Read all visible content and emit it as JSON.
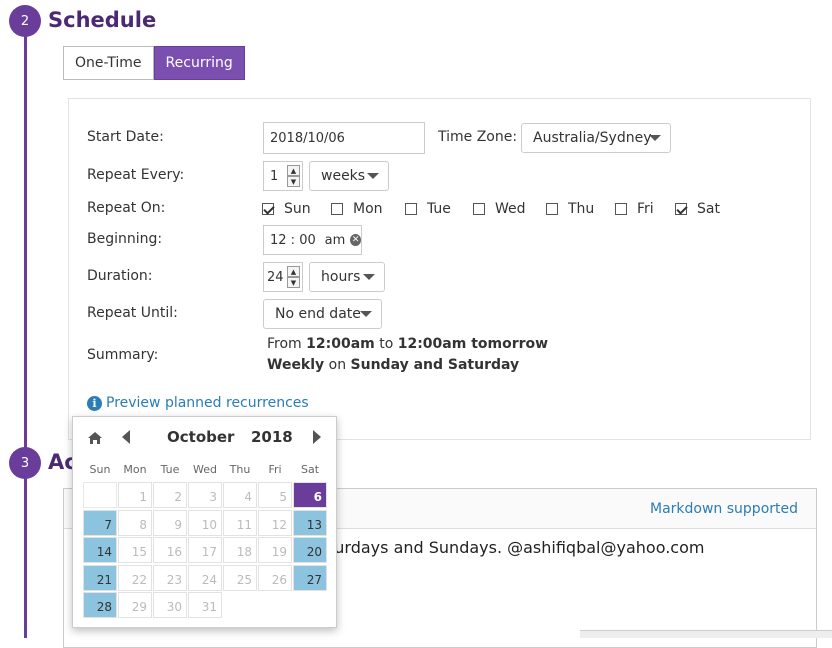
{
  "steps": [
    {
      "number": "2",
      "title": "Schedule"
    },
    {
      "number": "3",
      "title": "Ac"
    }
  ],
  "schedule_type": {
    "one_time": "One-Time",
    "recurring": "Recurring",
    "selected": "Recurring"
  },
  "form": {
    "start_date_label": "Start Date:",
    "start_date_value": "2018/10/06",
    "timezone_label": "Time Zone:",
    "timezone_value": "Australia/Sydney",
    "repeat_every_label": "Repeat Every:",
    "repeat_every_value": "1",
    "repeat_every_unit": "weeks",
    "repeat_on_label": "Repeat On:",
    "days": [
      {
        "label": "Sun",
        "checked": true
      },
      {
        "label": "Mon",
        "checked": false
      },
      {
        "label": "Tue",
        "checked": false
      },
      {
        "label": "Wed",
        "checked": false
      },
      {
        "label": "Thu",
        "checked": false
      },
      {
        "label": "Fri",
        "checked": false
      },
      {
        "label": "Sat",
        "checked": true
      }
    ],
    "beginning_label": "Beginning:",
    "beginning_hour": "12",
    "beginning_minute": "00",
    "beginning_ampm": "am",
    "duration_label": "Duration:",
    "duration_value": "24",
    "duration_unit": "hours",
    "repeat_until_label": "Repeat Until:",
    "repeat_until_value": "No end date",
    "summary_label": "Summary:",
    "summary": {
      "from": "From",
      "start": "12:00am",
      "to": "to",
      "end": "12:00am tomorrow",
      "frequency": "Weekly",
      "on": "on",
      "days": "Sunday and Saturday"
    },
    "preview_link": "Preview planned recurrences"
  },
  "editor": {
    "markdown_label": "Markdown supported",
    "text": "turdays and Sundays. @ashifiqbal@yahoo.com"
  },
  "calendar": {
    "month": "October",
    "year": "2018",
    "weekdays": [
      "Sun",
      "Mon",
      "Tue",
      "Wed",
      "Thu",
      "Fri",
      "Sat"
    ],
    "selected_day": 6,
    "weeks": [
      [
        null,
        1,
        2,
        3,
        4,
        5,
        6
      ],
      [
        7,
        8,
        9,
        10,
        11,
        12,
        13
      ],
      [
        14,
        15,
        16,
        17,
        18,
        19,
        20
      ],
      [
        21,
        22,
        23,
        24,
        25,
        26,
        27
      ],
      [
        28,
        29,
        30,
        31,
        null,
        null,
        null
      ]
    ]
  },
  "colors": {
    "primary": "#6a3d9a",
    "weekend_highlight": "#8cc3de",
    "link": "#2a7db5"
  }
}
